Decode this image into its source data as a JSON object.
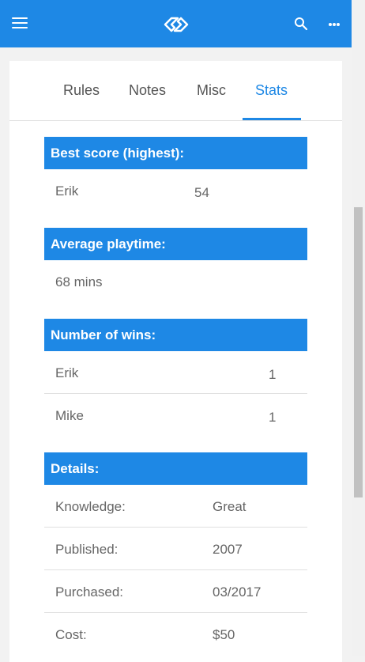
{
  "tabs": [
    {
      "label": "Rules"
    },
    {
      "label": "Notes"
    },
    {
      "label": "Misc"
    },
    {
      "label": "Stats"
    }
  ],
  "sections": {
    "best_score": {
      "title": "Best score (highest):",
      "rows": [
        {
          "name": "Erik",
          "value": "54"
        }
      ]
    },
    "average_playtime": {
      "title": "Average playtime:",
      "value": "68 mins"
    },
    "wins": {
      "title": "Number of wins:",
      "rows": [
        {
          "name": "Erik",
          "value": "1"
        },
        {
          "name": "Mike",
          "value": "1"
        }
      ]
    },
    "details": {
      "title": "Details:",
      "rows": [
        {
          "label": "Knowledge:",
          "value": "Great"
        },
        {
          "label": "Published:",
          "value": "2007"
        },
        {
          "label": "Purchased:",
          "value": "03/2017"
        },
        {
          "label": "Cost:",
          "value": "$50"
        }
      ]
    }
  },
  "icons": {
    "menu": "hamburger-menu-icon",
    "logo": "app-logo-icon",
    "search": "search-icon",
    "more": "more-horizontal-icon"
  },
  "colors": {
    "accent": "#1e88e5",
    "background": "#f2f2f2",
    "card": "#ffffff"
  }
}
